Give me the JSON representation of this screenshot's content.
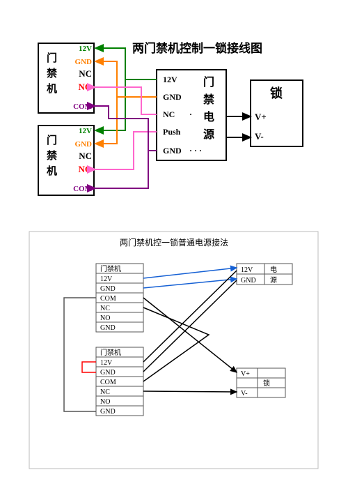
{
  "diagram1": {
    "title": "两门禁机控制一锁接线图",
    "reader1": {
      "label": "门禁机",
      "pins": [
        "12V",
        "GND",
        "NC",
        "NO",
        "COM"
      ],
      "pin_colors": [
        "#008000",
        "#ff8000",
        "#000000",
        "#ff0000",
        "#800080"
      ]
    },
    "reader2": {
      "label": "门禁机",
      "pins": [
        "12V",
        "GND",
        "NC",
        "NO",
        "COM"
      ],
      "pin_colors": [
        "#008000",
        "#ff8000",
        "#000000",
        "#ff0000",
        "#800080"
      ]
    },
    "psu": {
      "label": "门禁电源",
      "pins": [
        "12V",
        "GND",
        "NC",
        "Push",
        "GND"
      ]
    },
    "lock": {
      "label": "锁",
      "pins": [
        "V+",
        "V-"
      ]
    }
  },
  "diagram2": {
    "title": "两门禁机控一锁普通电源接法",
    "reader1": {
      "label": "门禁机",
      "pins": [
        "12V",
        "GND",
        "COM",
        "NC",
        "NO",
        "GND"
      ]
    },
    "reader2": {
      "label": "门禁机",
      "pins": [
        "12V",
        "GND",
        "COM",
        "NC",
        "NO",
        "GND"
      ]
    },
    "psu": {
      "label": "电源",
      "pins": [
        "12V",
        "GND"
      ]
    },
    "lock": {
      "label": "锁",
      "pins": [
        "V+",
        "V-"
      ]
    }
  }
}
